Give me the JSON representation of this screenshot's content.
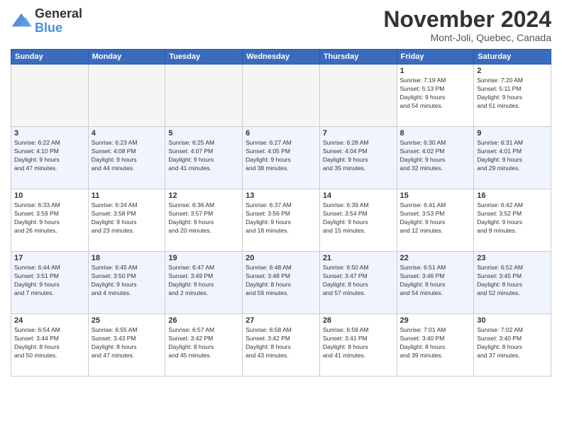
{
  "logo": {
    "line1": "General",
    "line2": "Blue"
  },
  "title": "November 2024",
  "location": "Mont-Joli, Quebec, Canada",
  "days_header": [
    "Sunday",
    "Monday",
    "Tuesday",
    "Wednesday",
    "Thursday",
    "Friday",
    "Saturday"
  ],
  "weeks": [
    {
      "alt": false,
      "days": [
        {
          "num": "",
          "empty": true,
          "info": ""
        },
        {
          "num": "",
          "empty": true,
          "info": ""
        },
        {
          "num": "",
          "empty": true,
          "info": ""
        },
        {
          "num": "",
          "empty": true,
          "info": ""
        },
        {
          "num": "",
          "empty": true,
          "info": ""
        },
        {
          "num": "1",
          "empty": false,
          "info": "Sunrise: 7:19 AM\nSunset: 5:13 PM\nDaylight: 9 hours\nand 54 minutes."
        },
        {
          "num": "2",
          "empty": false,
          "info": "Sunrise: 7:20 AM\nSunset: 5:11 PM\nDaylight: 9 hours\nand 51 minutes."
        }
      ]
    },
    {
      "alt": true,
      "days": [
        {
          "num": "3",
          "empty": false,
          "info": "Sunrise: 6:22 AM\nSunset: 4:10 PM\nDaylight: 9 hours\nand 47 minutes."
        },
        {
          "num": "4",
          "empty": false,
          "info": "Sunrise: 6:23 AM\nSunset: 4:08 PM\nDaylight: 9 hours\nand 44 minutes."
        },
        {
          "num": "5",
          "empty": false,
          "info": "Sunrise: 6:25 AM\nSunset: 4:07 PM\nDaylight: 9 hours\nand 41 minutes."
        },
        {
          "num": "6",
          "empty": false,
          "info": "Sunrise: 6:27 AM\nSunset: 4:05 PM\nDaylight: 9 hours\nand 38 minutes."
        },
        {
          "num": "7",
          "empty": false,
          "info": "Sunrise: 6:28 AM\nSunset: 4:04 PM\nDaylight: 9 hours\nand 35 minutes."
        },
        {
          "num": "8",
          "empty": false,
          "info": "Sunrise: 6:30 AM\nSunset: 4:02 PM\nDaylight: 9 hours\nand 32 minutes."
        },
        {
          "num": "9",
          "empty": false,
          "info": "Sunrise: 6:31 AM\nSunset: 4:01 PM\nDaylight: 9 hours\nand 29 minutes."
        }
      ]
    },
    {
      "alt": false,
      "days": [
        {
          "num": "10",
          "empty": false,
          "info": "Sunrise: 6:33 AM\nSunset: 3:59 PM\nDaylight: 9 hours\nand 26 minutes."
        },
        {
          "num": "11",
          "empty": false,
          "info": "Sunrise: 6:34 AM\nSunset: 3:58 PM\nDaylight: 9 hours\nand 23 minutes."
        },
        {
          "num": "12",
          "empty": false,
          "info": "Sunrise: 6:36 AM\nSunset: 3:57 PM\nDaylight: 9 hours\nand 20 minutes."
        },
        {
          "num": "13",
          "empty": false,
          "info": "Sunrise: 6:37 AM\nSunset: 3:56 PM\nDaylight: 9 hours\nand 18 minutes."
        },
        {
          "num": "14",
          "empty": false,
          "info": "Sunrise: 6:39 AM\nSunset: 3:54 PM\nDaylight: 9 hours\nand 15 minutes."
        },
        {
          "num": "15",
          "empty": false,
          "info": "Sunrise: 6:41 AM\nSunset: 3:53 PM\nDaylight: 9 hours\nand 12 minutes."
        },
        {
          "num": "16",
          "empty": false,
          "info": "Sunrise: 6:42 AM\nSunset: 3:52 PM\nDaylight: 9 hours\nand 9 minutes."
        }
      ]
    },
    {
      "alt": true,
      "days": [
        {
          "num": "17",
          "empty": false,
          "info": "Sunrise: 6:44 AM\nSunset: 3:51 PM\nDaylight: 9 hours\nand 7 minutes."
        },
        {
          "num": "18",
          "empty": false,
          "info": "Sunrise: 6:45 AM\nSunset: 3:50 PM\nDaylight: 9 hours\nand 4 minutes."
        },
        {
          "num": "19",
          "empty": false,
          "info": "Sunrise: 6:47 AM\nSunset: 3:49 PM\nDaylight: 9 hours\nand 2 minutes."
        },
        {
          "num": "20",
          "empty": false,
          "info": "Sunrise: 6:48 AM\nSunset: 3:48 PM\nDaylight: 8 hours\nand 59 minutes."
        },
        {
          "num": "21",
          "empty": false,
          "info": "Sunrise: 6:50 AM\nSunset: 3:47 PM\nDaylight: 8 hours\nand 57 minutes."
        },
        {
          "num": "22",
          "empty": false,
          "info": "Sunrise: 6:51 AM\nSunset: 3:46 PM\nDaylight: 8 hours\nand 54 minutes."
        },
        {
          "num": "23",
          "empty": false,
          "info": "Sunrise: 6:52 AM\nSunset: 3:45 PM\nDaylight: 8 hours\nand 52 minutes."
        }
      ]
    },
    {
      "alt": false,
      "days": [
        {
          "num": "24",
          "empty": false,
          "info": "Sunrise: 6:54 AM\nSunset: 3:44 PM\nDaylight: 8 hours\nand 50 minutes."
        },
        {
          "num": "25",
          "empty": false,
          "info": "Sunrise: 6:55 AM\nSunset: 3:43 PM\nDaylight: 8 hours\nand 47 minutes."
        },
        {
          "num": "26",
          "empty": false,
          "info": "Sunrise: 6:57 AM\nSunset: 3:42 PM\nDaylight: 8 hours\nand 45 minutes."
        },
        {
          "num": "27",
          "empty": false,
          "info": "Sunrise: 6:58 AM\nSunset: 3:42 PM\nDaylight: 8 hours\nand 43 minutes."
        },
        {
          "num": "28",
          "empty": false,
          "info": "Sunrise: 6:59 AM\nSunset: 3:41 PM\nDaylight: 8 hours\nand 41 minutes."
        },
        {
          "num": "29",
          "empty": false,
          "info": "Sunrise: 7:01 AM\nSunset: 3:40 PM\nDaylight: 8 hours\nand 39 minutes."
        },
        {
          "num": "30",
          "empty": false,
          "info": "Sunrise: 7:02 AM\nSunset: 3:40 PM\nDaylight: 8 hours\nand 37 minutes."
        }
      ]
    }
  ]
}
